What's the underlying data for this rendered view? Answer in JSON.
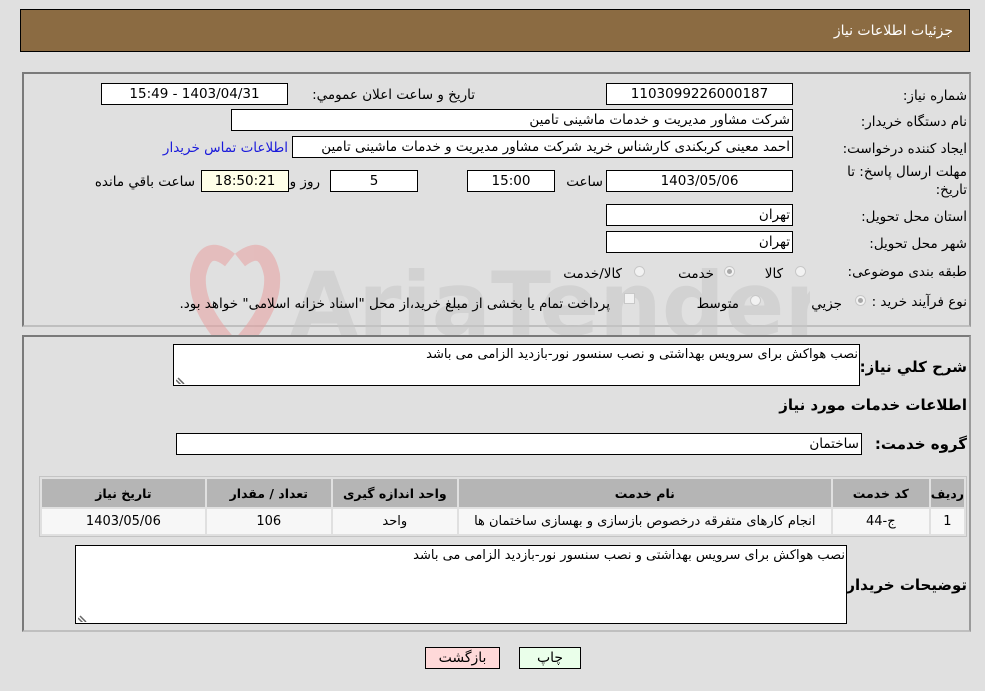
{
  "header": {
    "title": "جزئیات اطلاعات نیاز"
  },
  "details": {
    "need_number_label": "شماره نیاز:",
    "need_number": "1103099226000187",
    "announce_label": "تاریخ و ساعت اعلان عمومي:",
    "announce_value": "1403/04/31 - 15:49",
    "buyer_org_label": "نام دستگاه خریدار:",
    "buyer_org": "شرکت مشاور مدیریت و خدمات ماشینی تامین",
    "creator_label": "ایجاد کننده درخواست:",
    "creator": "احمد معینی کربکندی کارشناس خرید شرکت مشاور مدیریت و خدمات ماشینی تامین",
    "contact_link": "اطلاعات تماس خریدار",
    "deadline_label_1": "مهلت ارسال پاسخ: تا",
    "deadline_label_2": "تاریخ:",
    "deadline_date": "1403/05/06",
    "time_label": "ساعت",
    "deadline_time": "15:00",
    "days_value": "5",
    "days_label": "روز و",
    "remaining_time": "18:50:21",
    "remaining_label": "ساعت باقي مانده",
    "province_label": "استان محل تحویل:",
    "province": "تهران",
    "city_label": "شهر محل تحویل:",
    "city": "تهران",
    "category_label": "طبقه بندی موضوعی:",
    "category_options": [
      {
        "label": "کالا",
        "checked": false
      },
      {
        "label": "خدمت",
        "checked": true
      },
      {
        "label": "کالا/خدمت",
        "checked": false
      }
    ],
    "process_label": "نوع فرآیند خرید :",
    "process_options": [
      {
        "label": "جزیي",
        "checked": true
      },
      {
        "label": "متوسط",
        "checked": false
      }
    ],
    "treasury_note": "پرداخت تمام یا بخشی از مبلغ خرید،از محل \"اسناد خزانه اسلامی\" خواهد بود."
  },
  "description": {
    "label": "شرح کلي نیاز:",
    "text": "نصب هواکش برای سرویس بهداشتی و نصب سنسور نور-بازدید الزامی می باشد"
  },
  "services": {
    "section_title": "اطلاعات خدمات مورد نیاز",
    "group_label": "گروه خدمت:",
    "group_value": "ساختمان",
    "columns": [
      "ردیف",
      "کد خدمت",
      "نام خدمت",
      "واحد اندازه گیری",
      "تعداد / مقدار",
      "تاریخ نیاز"
    ],
    "rows": [
      [
        "1",
        "ج-44",
        "انجام کارهای متفرقه درخصوص بازسازی و بهسازی ساختمان ها",
        "واحد",
        "106",
        "1403/05/06"
      ]
    ]
  },
  "buyer_notes": {
    "label": "توضیحات خریدار:",
    "text": "نصب هواکش برای سرویس بهداشتی و نصب سنسور نور-بازدید الزامی می باشد"
  },
  "buttons": {
    "print": "چاپ",
    "back": "بازگشت"
  },
  "watermark": {
    "text": "AriaTender.net"
  },
  "colors": {
    "header_bg": "#8b6b42",
    "print_bg": "#eaffea",
    "back_bg": "#ffd9d9",
    "link": "#1a1adb"
  }
}
